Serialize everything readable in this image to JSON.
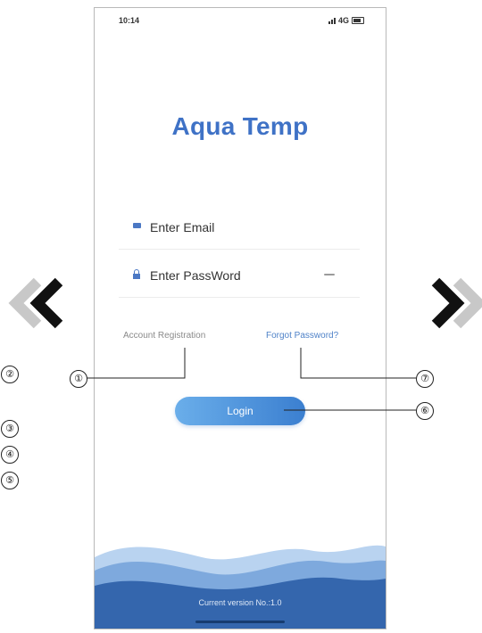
{
  "status_bar": {
    "time": "10:14",
    "right_text": "4G"
  },
  "app": {
    "title": "Aqua Temp",
    "email_placeholder": "Enter Email",
    "password_placeholder": "Enter PassWord",
    "register_link": "Account Registration",
    "forgot_link": "Forgot Password?",
    "login_button": "Login",
    "version_text": "Current version No.:1.0"
  },
  "callouts": {
    "c1": "①",
    "c2": "②",
    "c3": "③",
    "c4": "④",
    "c5": "⑤",
    "c6": "⑥",
    "c7": "⑦"
  },
  "icons": {
    "prev": "chevron-left-icon",
    "next": "chevron-right-icon",
    "email": "mail-icon",
    "password": "lock-icon",
    "visibility": "eye-icon"
  },
  "colors": {
    "brand": "#3f72c6",
    "button_start": "#6aaeea",
    "button_end": "#3b7fd0",
    "wave_dark": "#3466ad",
    "link": "#4f82c8"
  }
}
